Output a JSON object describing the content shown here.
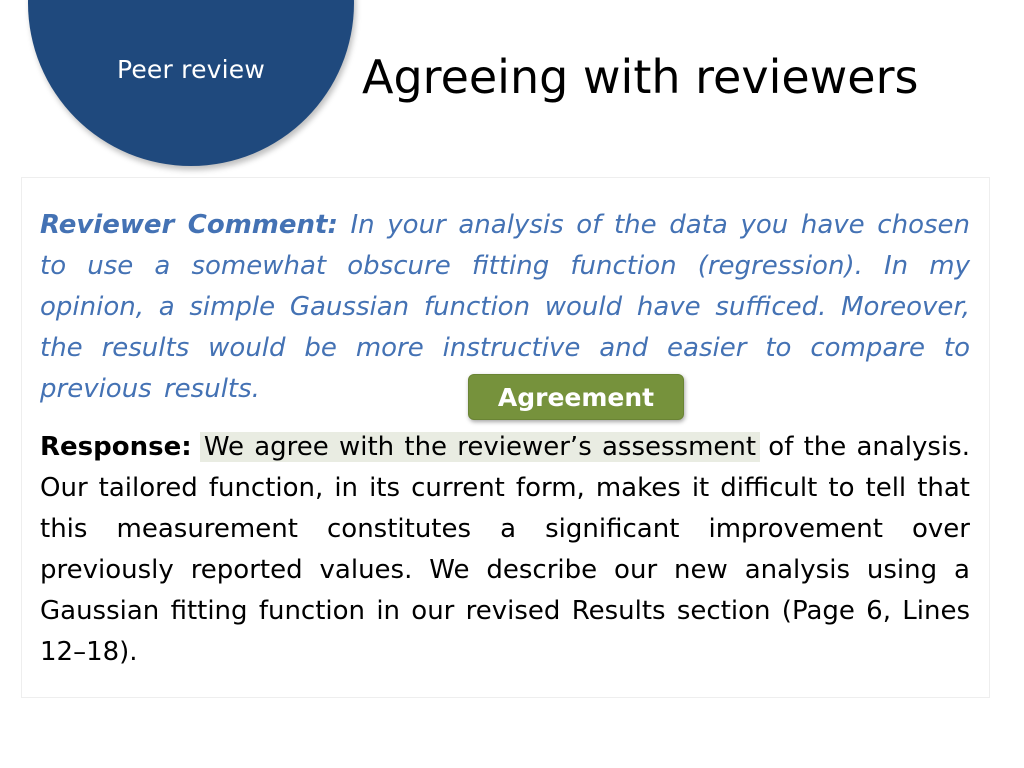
{
  "section_label": "Peer review",
  "title": "Agreeing with reviewers",
  "comment": {
    "label": "Reviewer Comment:",
    "text": " In your analysis of the data you have chosen to use a somewhat obscure fitting function (regression).  In my opinion, a simple Gaussian function would have sufficed. Moreover, the results would be more instructive and easier to compare to previous results."
  },
  "badge": {
    "label": "Agreement",
    "color": "#76923c"
  },
  "response": {
    "label": "Response:",
    "highlight": "We agree with the reviewer’s assessment",
    "text": " of the analysis. Our tailored function, in its current form, makes it difficult to tell that this measurement constitutes a significant improvement over previously reported values. We describe our new analysis using a Gaussian fitting function in our revised Results section (Page 6, Lines 12–18)."
  },
  "colors": {
    "circle": "#1f497d",
    "comment_text": "#4472b4",
    "highlight_bg": "#e9ece2"
  }
}
